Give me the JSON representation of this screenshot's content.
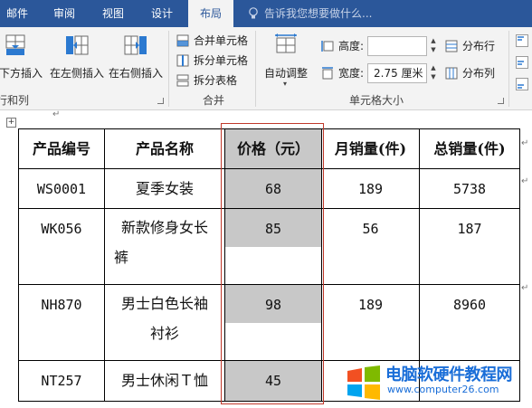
{
  "tabs": [
    {
      "label": "邮件"
    },
    {
      "label": "审阅"
    },
    {
      "label": "视图"
    },
    {
      "label": "设计"
    },
    {
      "label": "布局",
      "active": true
    }
  ],
  "tell_me": "告诉我您想要做什么...",
  "ribbon": {
    "rows_cols": {
      "insert_below": "在下方插入",
      "insert_left": "在左侧插入",
      "insert_right": "在右侧插入",
      "group_label": "行和列"
    },
    "merge": {
      "merge_cells": "合并单元格",
      "split_cells": "拆分单元格",
      "split_table": "拆分表格",
      "group_label": "合并"
    },
    "cell_size": {
      "autofit": "自动调整",
      "height_label": "高度:",
      "height_value": "",
      "width_label": "宽度:",
      "width_value": "2.75 厘米",
      "distribute_rows": "分布行",
      "distribute_cols": "分布列",
      "group_label": "单元格大小"
    }
  },
  "table": {
    "headers": [
      "产品编号",
      "产品名称",
      "价格（元）",
      "月销量(件)",
      "总销量(件)"
    ],
    "rows": [
      {
        "code": "WS0001",
        "name_line1": "夏季女装",
        "name_line2": "",
        "price": "68",
        "monthly": "189",
        "total": "5738"
      },
      {
        "code": "WK056",
        "name_line1": "新款修身女长",
        "name_line2": "裤",
        "price": "85",
        "monthly": "56",
        "total": "187"
      },
      {
        "code": "NH870",
        "name_line1": "男士白色长袖",
        "name_line2": "衬衫",
        "price": "98",
        "monthly": "189",
        "total": "8960"
      },
      {
        "code": "NT257",
        "name_line1": "男士休闲Ｔ恤",
        "name_line2": "",
        "price": "45",
        "monthly": "",
        "total": ""
      }
    ],
    "highlight_column": "价格（元）"
  },
  "watermark": {
    "title": "电脑软硬件教程网",
    "url": "www.computer26.com"
  },
  "colors": {
    "ribbon_blue": "#2b579a",
    "highlight_border": "#c0392b",
    "shade": "#c8c8c8",
    "watermark_blue": "#1a6ed8"
  }
}
